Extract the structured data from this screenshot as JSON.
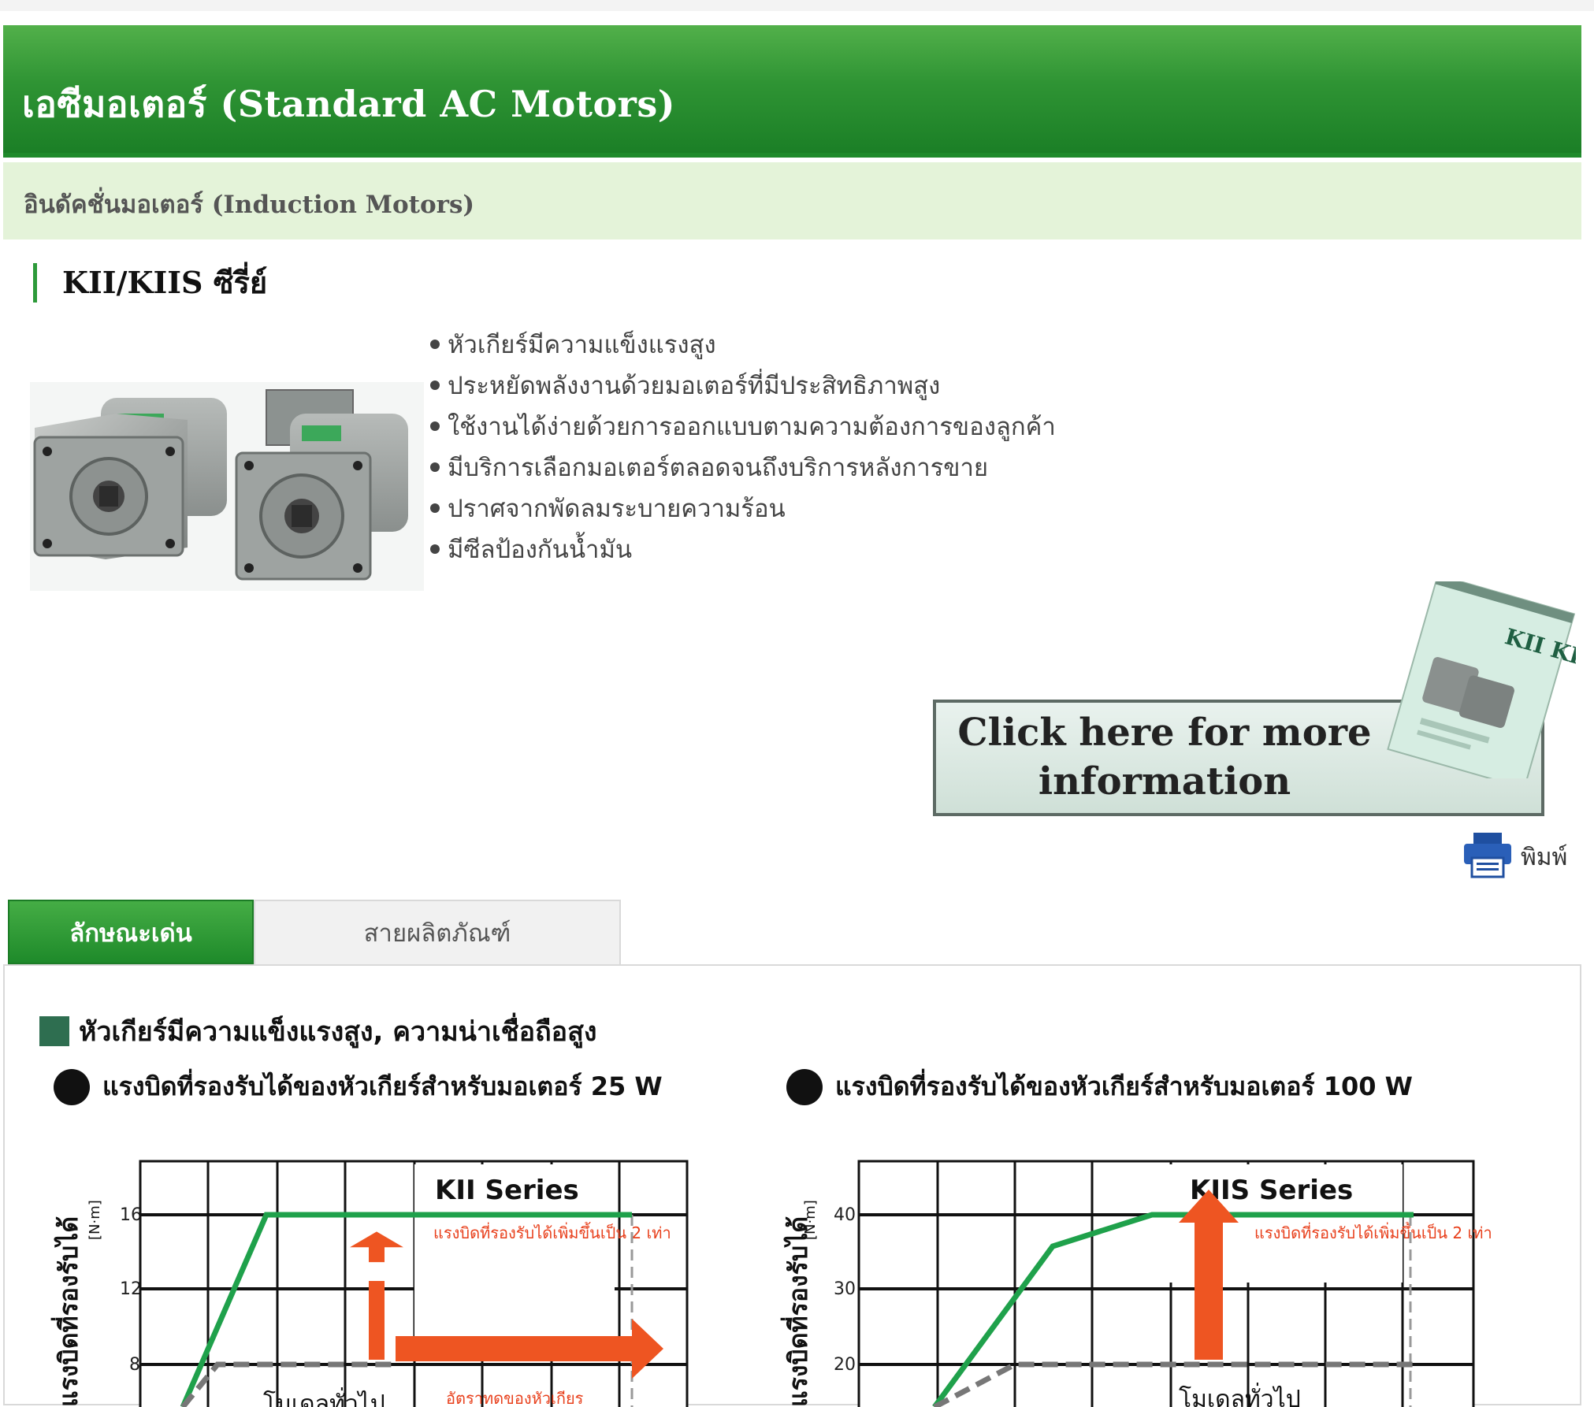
{
  "header": {
    "title": "เอซีมอเตอร์ (Standard AC Motors)",
    "subtitle": "อินดัคชั่นมอเตอร์ (Induction Motors)"
  },
  "series": {
    "name": "KII/KIIS ซีรี่ย์"
  },
  "features": [
    "หัวเกียร์มีความแข็งแรงสูง",
    "ประหยัดพลังงานด้วยมอเตอร์ที่มีประสิทธิภาพสูง",
    "ใช้งานได้ง่ายด้วยการออกแบบตามความต้องการของลูกค้า",
    "มีบริการเลือกมอเตอร์ตลอดจนถึงบริการหลังการขาย",
    "ปราศจากพัดลมระบายความร้อน",
    "มีซีลป้องกันน้ำมัน"
  ],
  "banner": {
    "line1": "Click here for more",
    "line2": "information",
    "brochure_text": "KII KIIS"
  },
  "print": {
    "label": "พิมพ์"
  },
  "tabs": [
    {
      "label": "ลักษณะเด่น",
      "active": true
    },
    {
      "label": "สายผลิตภัณฑ์",
      "active": false
    }
  ],
  "section": {
    "heading": "หัวเกียร์มีความแข็งแรงสูง, ความน่าเชื่อถือสูง"
  },
  "colors": {
    "header_green": "#2f9434",
    "sub_green": "#e4f3d9",
    "kii_line": "#1fa14b",
    "conventional_line": "#777777",
    "arrow_orange": "#ee5522",
    "annotation_red": "#e8401c"
  },
  "chart_data": [
    {
      "type": "line",
      "title": "แรงบิดที่รองรับได้ของหัวเกียร์สำหรับมอเตอร์ 25 W",
      "ylabel": "แรงบิดที่รองรับได้",
      "yunit": "[N·m]",
      "yticks": [
        8,
        12,
        16
      ],
      "series_label": "KII Series",
      "annotation_up": "แรงบิดที่รองรับได้เพิ่มขึ้นเป็น 2 เท่า",
      "annotation_right": "อัตราทดของหัวเกียร",
      "conventional_label": "โมเดลทั่วไป",
      "series": [
        {
          "name": "KII Series",
          "color": "#1fa14b"
        },
        {
          "name": "โมเดลทั่วไป",
          "color": "#777777"
        }
      ],
      "kii_y": [
        0,
        16,
        16
      ],
      "conventional_y": [
        0,
        8,
        8
      ]
    },
    {
      "type": "line",
      "title": "แรงบิดที่รองรับได้ของหัวเกียร์สำหรับมอเตอร์ 100 W",
      "ylabel": "แรงบิดที่รองรับได้",
      "yunit": "[N·m]",
      "yticks": [
        20,
        30,
        40
      ],
      "series_label": "KIIS Series",
      "annotation_up": "แรงบิดที่รองรับได้เพิ่มขึ้นเป็น 2 เท่า",
      "conventional_label": "โมเดลทั่วไป",
      "series": [
        {
          "name": "KIIS Series",
          "color": "#1fa14b"
        },
        {
          "name": "โมเดลทั่วไป",
          "color": "#777777"
        }
      ],
      "kiis_y": [
        0,
        36,
        40,
        40
      ],
      "conventional_y": [
        0,
        20,
        20
      ]
    }
  ]
}
